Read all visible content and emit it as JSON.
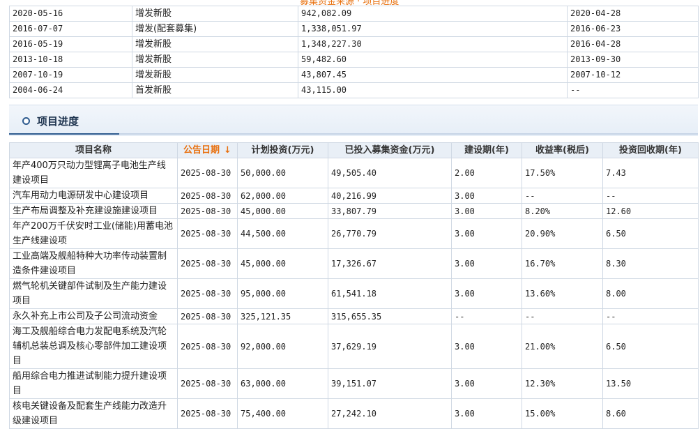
{
  "top_clip_text": "募集资金来源 · 项目进度",
  "issue_rows": [
    {
      "date": "2020-05-16",
      "type": "增发新股",
      "amount": "942,082.09",
      "date2": "2020-04-28"
    },
    {
      "date": "2016-07-07",
      "type": "增发(配套募集)",
      "amount": "1,338,051.97",
      "date2": "2016-06-23"
    },
    {
      "date": "2016-05-19",
      "type": "增发新股",
      "amount": "1,348,227.30",
      "date2": "2016-04-28"
    },
    {
      "date": "2013-10-18",
      "type": "增发新股",
      "amount": "59,482.60",
      "date2": "2013-09-30"
    },
    {
      "date": "2007-10-19",
      "type": "增发新股",
      "amount": "43,807.45",
      "date2": "2007-10-12"
    },
    {
      "date": "2004-06-24",
      "type": "首发新股",
      "amount": "43,115.00",
      "date2": "--"
    }
  ],
  "section": {
    "title": "项目进度"
  },
  "progress": {
    "headers": {
      "name": "项目名称",
      "date": "公告日期",
      "sort_arrow": "↓",
      "plan": "计划投资(万元)",
      "invested": "已投入募集资金(万元)",
      "period": "建设期(年)",
      "yield": "收益率(税后)",
      "payback": "投资回收期(年)"
    },
    "rows": [
      {
        "name": "年产400万只动力型锂离子电池生产线建设项目",
        "date": "2025-08-30",
        "plan": "50,000.00",
        "invested": "49,505.40",
        "period": "2.00",
        "yield": "17.50%",
        "payback": "7.43"
      },
      {
        "name": "汽车用动力电源研发中心建设项目",
        "date": "2025-08-30",
        "plan": "62,000.00",
        "invested": "40,216.99",
        "period": "3.00",
        "yield": "--",
        "payback": "--"
      },
      {
        "name": "生产布局调整及补充建设施建设项目",
        "date": "2025-08-30",
        "plan": "45,000.00",
        "invested": "33,807.79",
        "period": "3.00",
        "yield": "8.20%",
        "payback": "12.60"
      },
      {
        "name": "年产200万千伏安时工业(储能)用蓄电池生产线建设项",
        "date": "2025-08-30",
        "plan": "44,500.00",
        "invested": "26,770.79",
        "period": "3.00",
        "yield": "20.90%",
        "payback": "6.50"
      },
      {
        "name": "工业高端及舰船特种大功率传动装置制造条件建设项目",
        "date": "2025-08-30",
        "plan": "45,000.00",
        "invested": "17,326.67",
        "period": "3.00",
        "yield": "16.70%",
        "payback": "8.30"
      },
      {
        "name": "燃气轮机关键部件试制及生产能力建设项目",
        "date": "2025-08-30",
        "plan": "95,000.00",
        "invested": "61,541.18",
        "period": "3.00",
        "yield": "13.60%",
        "payback": "8.00"
      },
      {
        "name": "永久补充上市公司及子公司流动资金",
        "date": "2025-08-30",
        "plan": "325,121.35",
        "invested": "315,655.35",
        "period": "--",
        "yield": "--",
        "payback": "--"
      },
      {
        "name": "海工及舰船综合电力发配电系统及汽轮辅机总装总调及核心零部件加工建设项目",
        "date": "2025-08-30",
        "plan": "92,000.00",
        "invested": "37,629.19",
        "period": "3.00",
        "yield": "21.00%",
        "payback": "6.50"
      },
      {
        "name": "船用综合电力推进试制能力提升建设项目",
        "date": "2025-08-30",
        "plan": "63,000.00",
        "invested": "39,151.07",
        "period": "3.00",
        "yield": "12.30%",
        "payback": "13.50"
      },
      {
        "name": "核电关键设备及配套生产线能力改造升级建设项目",
        "date": "2025-08-30",
        "plan": "75,400.00",
        "invested": "27,242.10",
        "period": "3.00",
        "yield": "15.00%",
        "payback": "8.60"
      }
    ]
  }
}
